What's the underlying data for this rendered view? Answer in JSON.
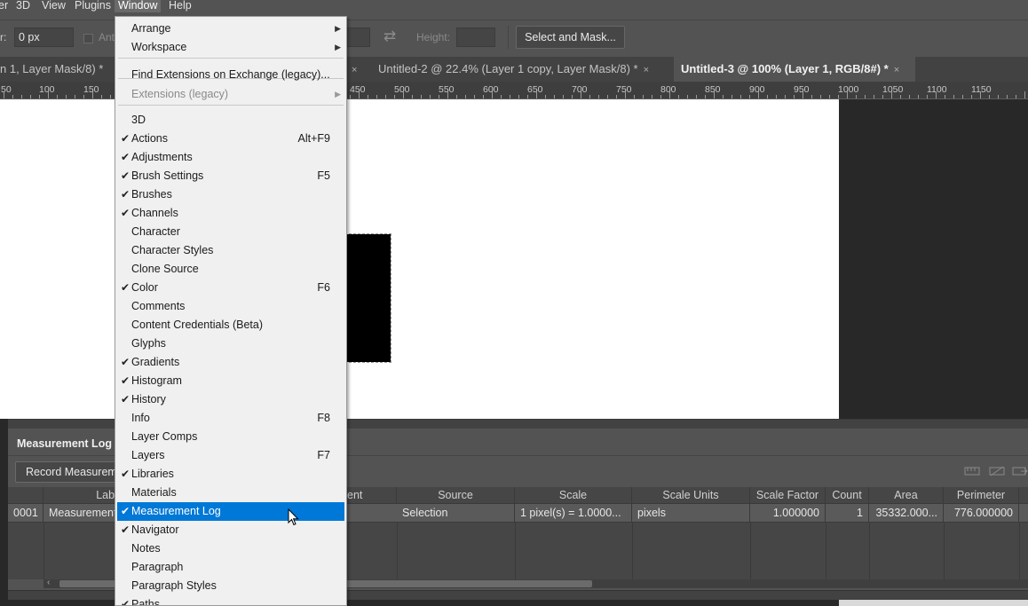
{
  "menubar": {
    "items": [
      {
        "label": "er"
      },
      {
        "label": "3D"
      },
      {
        "label": "View"
      },
      {
        "label": "Plugins"
      },
      {
        "label": "Window"
      },
      {
        "label": "Help"
      }
    ]
  },
  "options": {
    "field1_label": "r:",
    "field1_value": "0 px",
    "antialias_label": "Anti",
    "height_label": "Height:",
    "select_mask_label": "Select and Mask..."
  },
  "tabs": [
    {
      "label": "n 1, Layer Mask/8) *",
      "close": "×"
    },
    {
      "label": "Untitled-2 @ 22.4% (Layer 1 copy, Layer Mask/8) *",
      "close": "×"
    },
    {
      "label": "Untitled-3 @ 100% (Layer 1, RGB/8#) *",
      "close": "×"
    }
  ],
  "ruler": {
    "labels": [
      "50",
      "100",
      "150",
      "450",
      "500",
      "550",
      "600",
      "650",
      "700",
      "750",
      "800",
      "850",
      "900",
      "950",
      "1000",
      "1050",
      "1100",
      "1150"
    ]
  },
  "window_menu": {
    "items": [
      {
        "label": "Arrange",
        "checked": false,
        "shortcut": "",
        "submenu": true
      },
      {
        "label": "Workspace",
        "checked": false,
        "shortcut": "",
        "submenu": true
      },
      {
        "label": "Find Extensions on Exchange (legacy)...",
        "checked": false,
        "shortcut": ""
      },
      {
        "label": "Extensions (legacy)",
        "checked": false,
        "shortcut": "",
        "submenu": true,
        "disabled": true
      },
      {
        "label": "3D",
        "checked": false,
        "shortcut": ""
      },
      {
        "label": "Actions",
        "checked": true,
        "shortcut": "Alt+F9"
      },
      {
        "label": "Adjustments",
        "checked": true,
        "shortcut": ""
      },
      {
        "label": "Brush Settings",
        "checked": true,
        "shortcut": "F5"
      },
      {
        "label": "Brushes",
        "checked": true,
        "shortcut": ""
      },
      {
        "label": "Channels",
        "checked": true,
        "shortcut": ""
      },
      {
        "label": "Character",
        "checked": false,
        "shortcut": ""
      },
      {
        "label": "Character Styles",
        "checked": false,
        "shortcut": ""
      },
      {
        "label": "Clone Source",
        "checked": false,
        "shortcut": ""
      },
      {
        "label": "Color",
        "checked": true,
        "shortcut": "F6"
      },
      {
        "label": "Comments",
        "checked": false,
        "shortcut": ""
      },
      {
        "label": "Content Credentials (Beta)",
        "checked": false,
        "shortcut": ""
      },
      {
        "label": "Glyphs",
        "checked": false,
        "shortcut": ""
      },
      {
        "label": "Gradients",
        "checked": true,
        "shortcut": ""
      },
      {
        "label": "Histogram",
        "checked": true,
        "shortcut": ""
      },
      {
        "label": "History",
        "checked": true,
        "shortcut": ""
      },
      {
        "label": "Info",
        "checked": false,
        "shortcut": "F8"
      },
      {
        "label": "Layer Comps",
        "checked": false,
        "shortcut": ""
      },
      {
        "label": "Layers",
        "checked": false,
        "shortcut": "F7"
      },
      {
        "label": "Libraries",
        "checked": true,
        "shortcut": ""
      },
      {
        "label": "Materials",
        "checked": false,
        "shortcut": ""
      },
      {
        "label": "Measurement Log",
        "checked": true,
        "shortcut": "",
        "highlighted": true
      },
      {
        "label": "Navigator",
        "checked": true,
        "shortcut": ""
      },
      {
        "label": "Notes",
        "checked": false,
        "shortcut": ""
      },
      {
        "label": "Paragraph",
        "checked": false,
        "shortcut": ""
      },
      {
        "label": "Paragraph Styles",
        "checked": false,
        "shortcut": ""
      },
      {
        "label": "Paths",
        "checked": true,
        "shortcut": ""
      }
    ],
    "check_glyph": "✔",
    "submenu_glyph": "▶"
  },
  "measurement_log": {
    "title": "Measurement Log",
    "record_button": "Record Measurements",
    "columns": [
      "Label",
      "Document",
      "Source",
      "Scale",
      "Scale Units",
      "Scale Factor",
      "Count",
      "Area",
      "Perimeter"
    ],
    "header_visible": [
      "",
      "Labe",
      "ent",
      "Source",
      "Scale",
      "Scale Units",
      "Scale Factor",
      "Count",
      "Area",
      "Perimeter"
    ],
    "row": {
      "id": "0001",
      "label": "Measurement",
      "source": "Selection",
      "scale": "1 pixel(s) = 1.0000...",
      "scale_units": "pixels",
      "scale_factor": "1.000000",
      "count": "1",
      "area": "35332.000...",
      "perimeter": "776.000000"
    }
  },
  "colors": {
    "menu_highlight": "#0078d7",
    "ui_gray": "#535353",
    "canvas": "#ffffff"
  }
}
